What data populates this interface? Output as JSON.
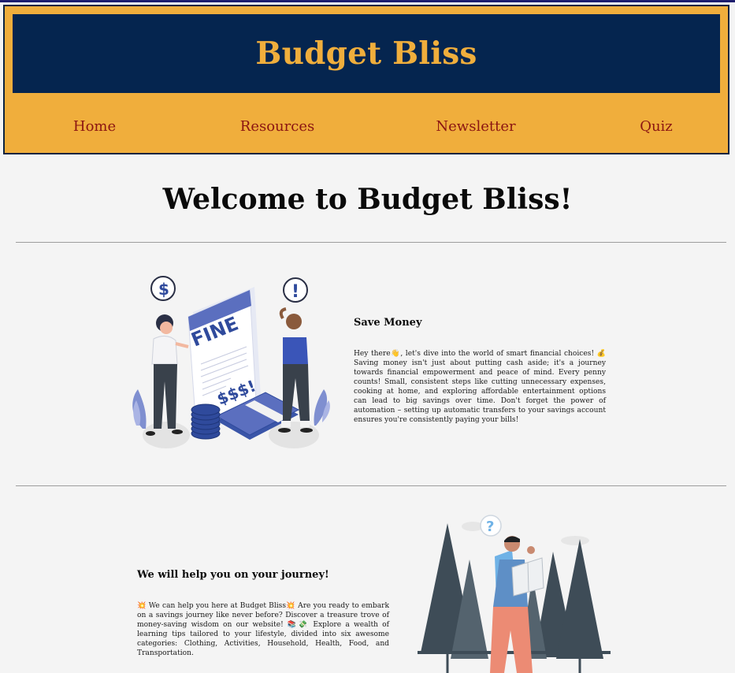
{
  "header": {
    "site_title": "Budget Bliss",
    "nav": [
      "Home",
      "Resources",
      "Newsletter",
      "Quiz"
    ]
  },
  "main": {
    "welcome_heading": "Welcome to Budget Bliss!",
    "sections": [
      {
        "title": "Save Money",
        "text": "Hey there👋, let's dive into the world of smart financial choices! 💰 Saving money isn't just about putting cash aside; it's a journey towards financial empowerment and peace of mind. Every penny counts! Small, consistent steps like cutting unnecessary expenses, cooking at home, and exploring affordable entertainment options can lead to big savings over time. Don't forget the power of automation – setting up automatic transfers to your savings account ensures you're consistently paying your bills!",
        "illustration": {
          "icon": "fine-payment-illustration",
          "fine_label": "FINE",
          "amount_label": "$$$!",
          "dollar_bubble": "$",
          "alert_bubble": "!"
        }
      },
      {
        "title": "We will help you on your journey!",
        "text": "💥 We can help you here at Budget Bliss💥 Are you ready to embark on a savings journey like never before? Discover a treasure trove of money-saving wisdom on our website! 📚💸 Explore a wealth of learning tips tailored to your lifestyle, divided into six awesome categories: Clothing, Activities, Household, Health, Food, and Transportation.",
        "illustration": {
          "icon": "hiker-map-forest-illustration",
          "question_bubble": "?"
        }
      }
    ]
  },
  "colors": {
    "header_gold": "#f0ae3c",
    "header_navy": "#05254f",
    "nav_link": "#8b1512",
    "page_bg": "#f4f4f4",
    "illustration_blue": "#2f4a9c"
  }
}
